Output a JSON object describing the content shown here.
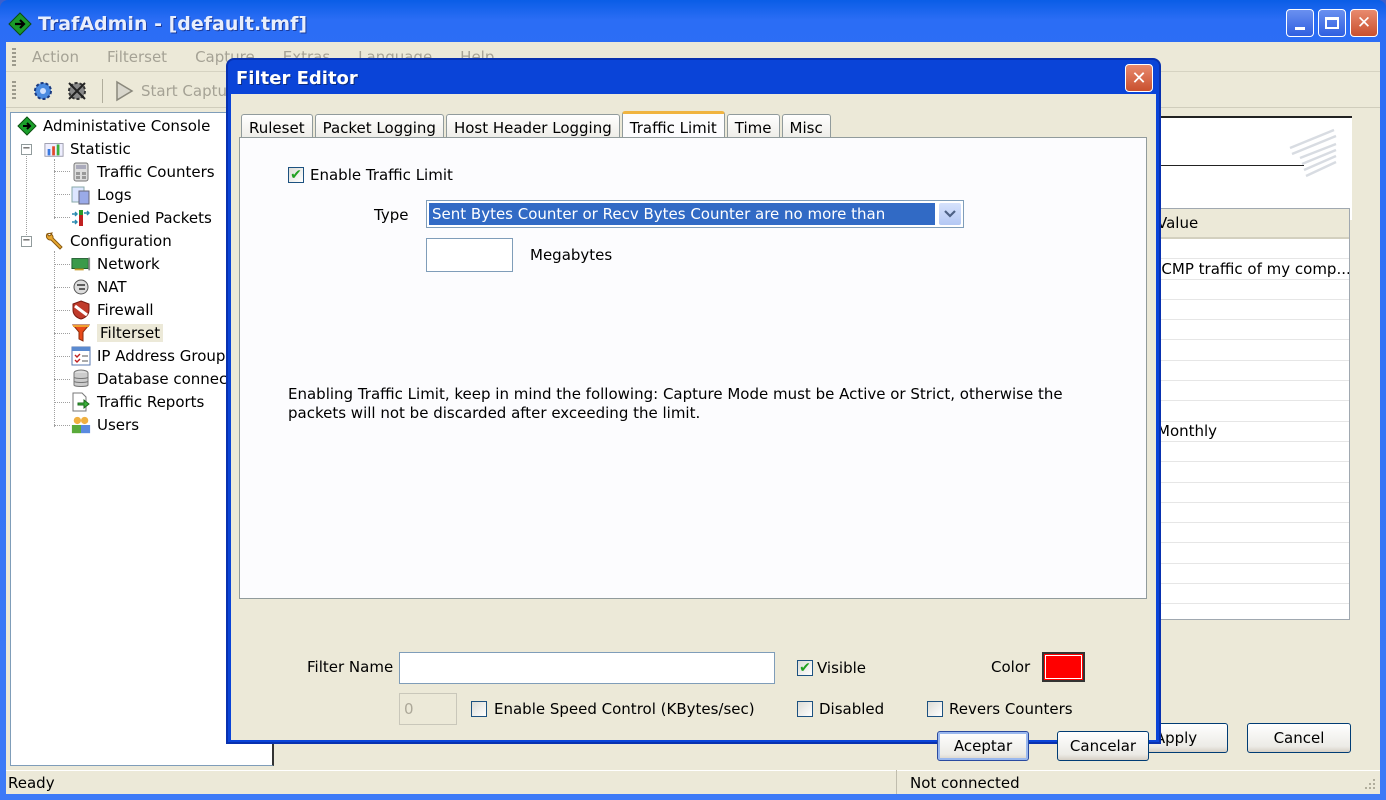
{
  "window": {
    "title": "TrafAdmin - [default.tmf]",
    "minimize_label": "_",
    "maximize_label": "☐",
    "close_label": "✕"
  },
  "menubar": {
    "items": [
      "Action",
      "Filterset",
      "Capture",
      "Extras",
      "Language",
      "Help"
    ]
  },
  "toolbar": {
    "start_capture_label": "Start Capture"
  },
  "tree": {
    "root": "Administative Console",
    "statistic": {
      "label": "Statistic",
      "children": [
        "Traffic Counters",
        "Logs",
        "Denied Packets"
      ]
    },
    "configuration": {
      "label": "Configuration",
      "children": [
        "Network",
        "NAT",
        "Firewall",
        "Filterset",
        "IP Address Groups",
        "Database connections",
        "Traffic Reports",
        "Users"
      ]
    },
    "selected": "Filterset"
  },
  "rightpane": {
    "grid_header": "Value",
    "grid_rows": [
      "",
      "ICMP traffic of my comp...",
      "",
      "",
      "",
      "",
      "",
      "",
      "",
      "Monthly",
      "",
      "",
      "",
      "",
      "",
      "",
      "",
      ""
    ],
    "apply_label": "Apply",
    "cancel_label": "Cancel"
  },
  "statusbar": {
    "left": "Ready",
    "middle": "Not connected"
  },
  "dialog": {
    "title": "Filter Editor",
    "close_label": "✕",
    "tabs": [
      "Ruleset",
      "Packet Logging",
      "Host Header Logging",
      "Traffic Limit",
      "Time",
      "Misc"
    ],
    "active_tab": "Traffic Limit",
    "traffic_limit": {
      "enable_label": "Enable Traffic Limit",
      "enable_checked": true,
      "type_label": "Type",
      "type_value": "Sent Bytes Counter or Recv Bytes Counter are no more than",
      "amount_value": "",
      "unit_label": "Megabytes",
      "note": "Enabling Traffic Limit, keep in mind the following: Capture Mode must be Active or Strict, otherwise the packets will not be discarded after exceeding the limit."
    },
    "filter_name_label": "Filter Name",
    "filter_name_value": "",
    "speed_value": "0",
    "speed_control_label": "Enable Speed Control (KBytes/sec)",
    "speed_control_checked": false,
    "visible_label": "Visible",
    "visible_checked": true,
    "disabled_label": "Disabled",
    "disabled_checked": false,
    "revers_label": "Revers Counters",
    "revers_checked": false,
    "color_label": "Color",
    "color_value": "#ff0000",
    "ok_label": "Aceptar",
    "cancel_label": "Cancelar"
  }
}
